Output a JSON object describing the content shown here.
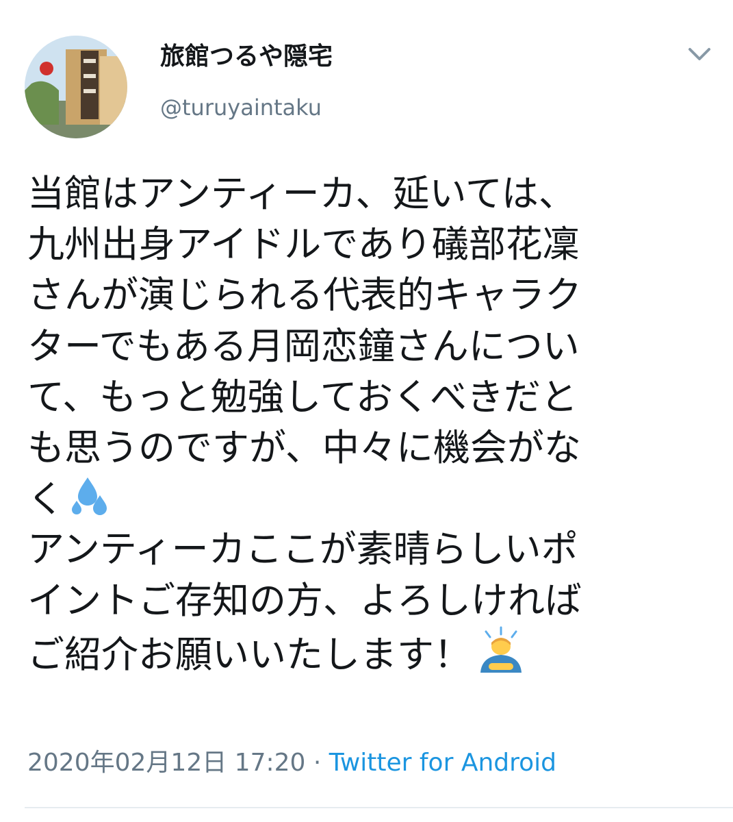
{
  "user": {
    "display_name": "旅館つるや隠宅",
    "handle": "@turuyaintaku"
  },
  "tweet": {
    "lines": [
      "当館はアンティーカ、延いては、",
      "九州出身アイドルであり礒部花凜",
      "さんが演じられる代表的キャラク",
      "ターでもある月岡恋鐘さんについ",
      "て、もっと勉強しておくべきだと",
      "も思うのですが、中々に機会がな",
      "く",
      "アンティーカここが素晴らしいポ",
      "イントご存知の方、よろしければ",
      "ご紹介お願いいたします！"
    ],
    "emoji_sweat": "sweat-droplets-icon",
    "emoji_bowing": "person-bowing-icon"
  },
  "meta": {
    "timestamp": "2020年02月12日 17:20",
    "separator": " · ",
    "source": "Twitter for Android"
  },
  "colors": {
    "text": "#14171a",
    "secondary": "#657786",
    "link": "#1b95e0",
    "divider": "#e6ecf0"
  }
}
